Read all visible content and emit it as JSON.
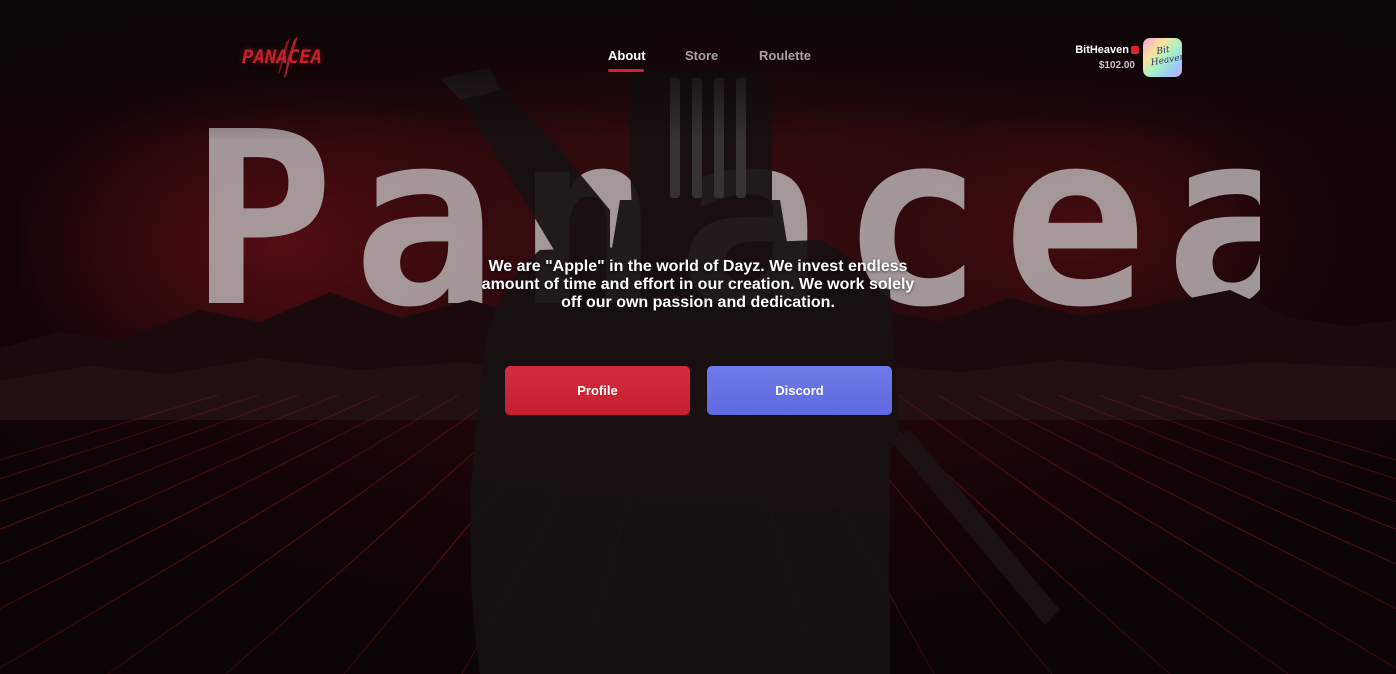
{
  "brand": {
    "logo_text": "PANACEA",
    "accent_color": "#d72033"
  },
  "hero_background_text": "Panacea",
  "nav": {
    "items": [
      {
        "label": "About",
        "active": true
      },
      {
        "label": "Store",
        "active": false
      },
      {
        "label": "Roulette",
        "active": false
      }
    ]
  },
  "user": {
    "name": "BitHeaven",
    "balance": "$102.00",
    "avatar_text": "Bit Heaven"
  },
  "hero": {
    "tagline": "We are \"Apple\" in the world of Dayz. We invest endless amount of time and effort in our creation. We work solely off our own passion and dedication."
  },
  "buttons": {
    "profile_label": "Profile",
    "profile_color": "#c9222f",
    "discord_label": "Discord",
    "discord_color": "#6570e3"
  }
}
